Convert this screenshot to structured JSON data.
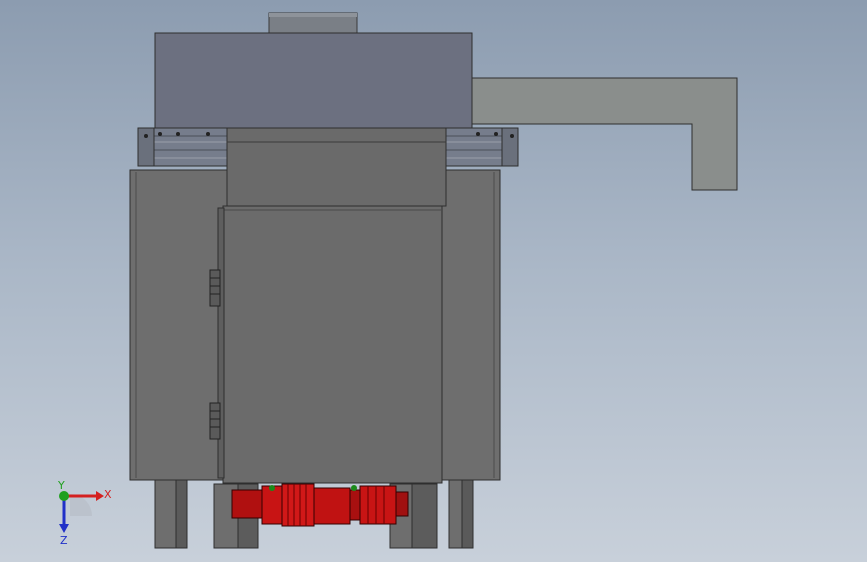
{
  "triad": {
    "x_label": "X",
    "y_label": "Y",
    "z_label": "Z",
    "x_color": "#d42020",
    "y_color": "#20a020",
    "z_color": "#2030c8"
  },
  "model": {
    "body_color": "#6e6e6e",
    "top_housing_color": "#6c7080",
    "arm_color": "#8a8e8c",
    "motor_color": "#c81414"
  }
}
